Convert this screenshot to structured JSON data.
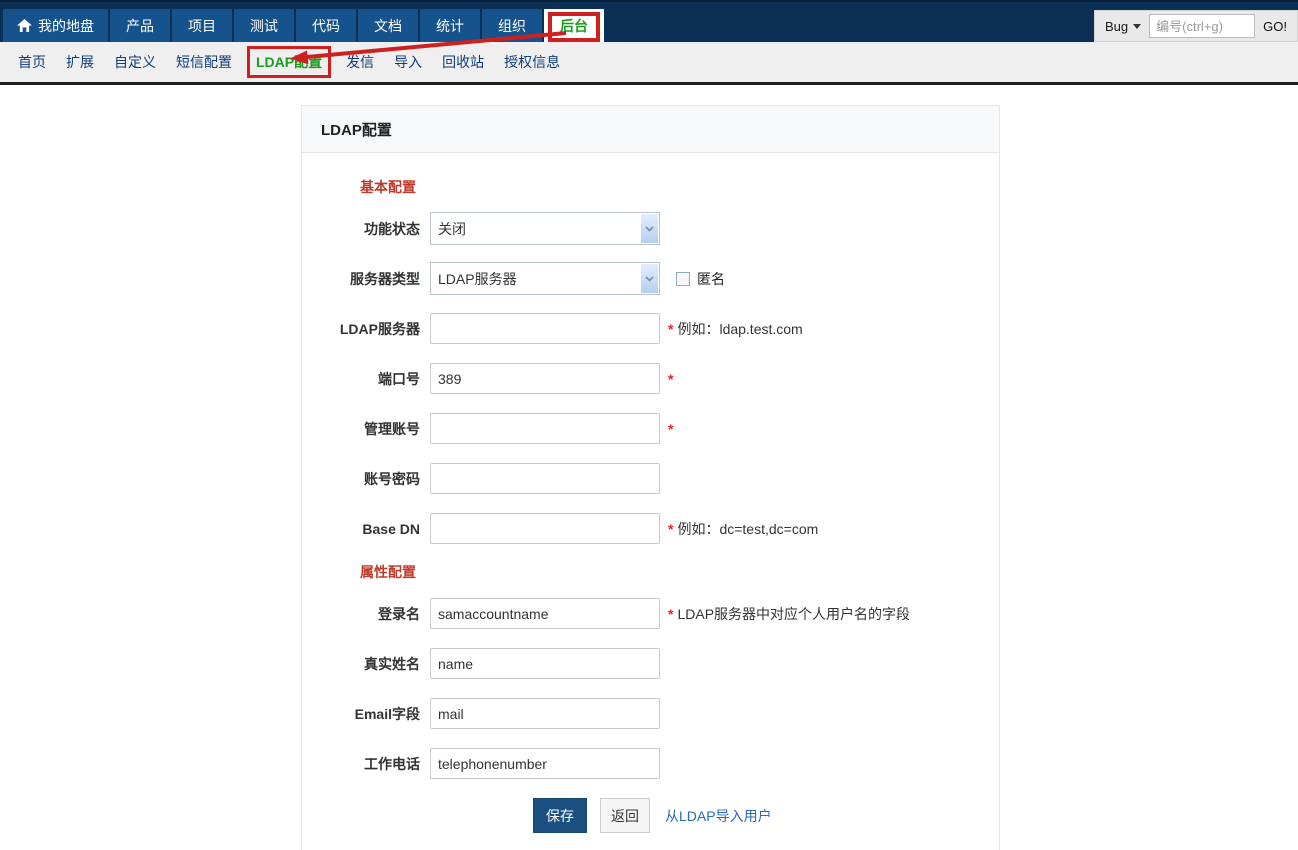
{
  "colors": {
    "topbar_bg": "#0b2f55",
    "nav_item_bg": "#16538d",
    "active_green": "#1e9a1e",
    "annotation_red": "#cf2020",
    "section_heading_red": "#c0392b",
    "required_red": "#e62222",
    "link_blue": "#2a6bb5",
    "save_button_blue": "#1a5080",
    "subnav_text_blue": "#0e3d7a"
  },
  "topnav": {
    "home": {
      "label": "我的地盘"
    },
    "items": [
      "产品",
      "项目",
      "测试",
      "代码",
      "文档",
      "统计",
      "组织"
    ],
    "backend": "后台",
    "search": {
      "module": "Bug",
      "placeholder": "编号(ctrl+g)",
      "go": "GO!"
    }
  },
  "subnav": {
    "items_before": [
      "首页",
      "扩展",
      "自定义",
      "短信配置"
    ],
    "active": "LDAP配置",
    "items_after": [
      "发信",
      "导入",
      "回收站",
      "授权信息"
    ]
  },
  "panel": {
    "title": "LDAP配置",
    "sections": {
      "basic": "基本配置",
      "attributes": "属性配置"
    },
    "fields": {
      "status": {
        "label": "功能状态",
        "value": "关闭"
      },
      "type": {
        "label": "服务器类型",
        "value": "LDAP服务器",
        "checkbox_label": "匿名"
      },
      "host": {
        "label": "LDAP服务器",
        "value": "",
        "required": "*",
        "hint": "例如：ldap.test.com"
      },
      "port": {
        "label": "端口号",
        "value": "389",
        "required": "*"
      },
      "account": {
        "label": "管理账号",
        "value": "",
        "required": "*"
      },
      "password": {
        "label": "账号密码",
        "value": ""
      },
      "basedn": {
        "label": "Base DN",
        "value": "",
        "required": "*",
        "hint": "例如：dc=test,dc=com"
      },
      "login": {
        "label": "登录名",
        "value": "samaccountname",
        "required": "*",
        "hint": "LDAP服务器中对应个人用户名的字段"
      },
      "realname": {
        "label": "真实姓名",
        "value": "name"
      },
      "email": {
        "label": "Email字段",
        "value": "mail"
      },
      "phone": {
        "label": "工作电话",
        "value": "telephonenumber"
      }
    },
    "actions": {
      "save": "保存",
      "back": "返回",
      "import_link": "从LDAP导入用户"
    }
  }
}
